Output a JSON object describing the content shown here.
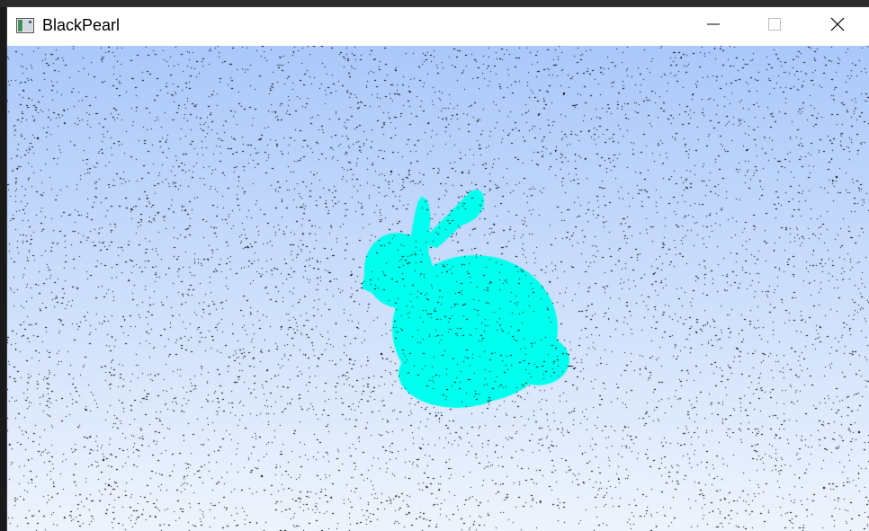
{
  "window": {
    "title": "BlackPearl",
    "icon": "app-window-icon",
    "controls": {
      "minimize_icon": "minimize-icon",
      "maximize_icon": "maximize-icon",
      "close_icon": "close-icon"
    }
  },
  "viewport": {
    "description_icon": "point-cloud-canvas",
    "background_top_color": "#aac8fa",
    "background_bottom_color": "#eef4fd",
    "noise_color": "#000000",
    "model_color": "#00ffee"
  }
}
